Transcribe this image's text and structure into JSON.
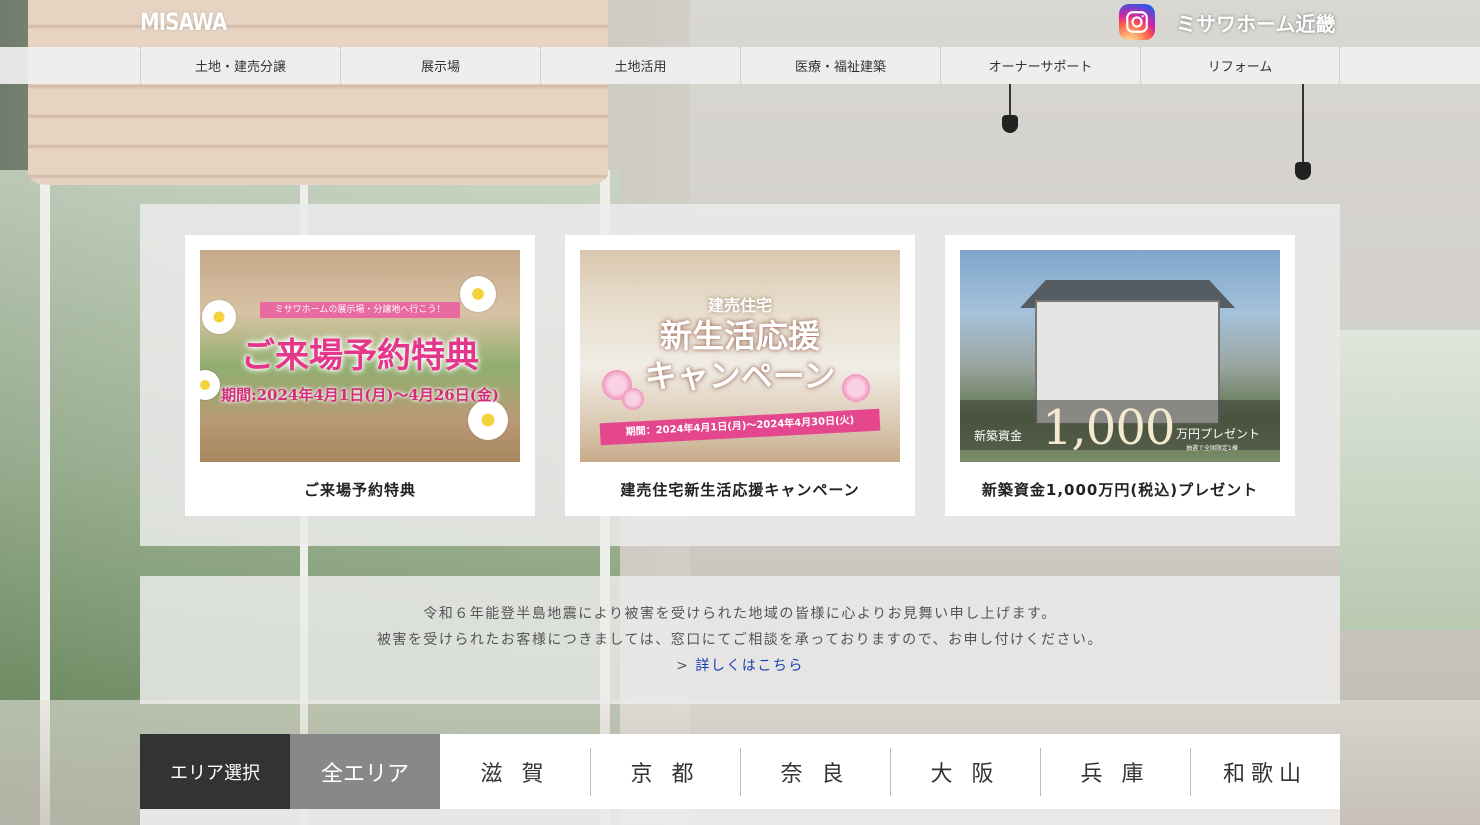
{
  "header": {
    "logo_text": "MISAWA",
    "brand_text": "ミサワホーム近畿",
    "nav": [
      "土地・建売分譲",
      "展示場",
      "土地活用",
      "医療・福祉建築",
      "オーナーサポート",
      "リフォーム"
    ]
  },
  "campaigns": [
    {
      "caption": "ご来場予約特典",
      "banner": {
        "ribbon": "ミサワホームの展示場・分譲地へ行こう！",
        "headline": "ご来場予約特典",
        "period": "期間:2024年4月1日(月)〜4月26日(金)"
      }
    },
    {
      "caption": "建売住宅新生活応援キャンペーン",
      "banner": {
        "kicker": "建売住宅",
        "headline_1": "新生活応援",
        "headline_2": "キャンペーン",
        "period": "期間：2024年4月1日(月)〜2024年4月30日(火)"
      }
    },
    {
      "caption": "新築資金1,000万円(税込)プレゼント",
      "banner": {
        "label_left": "新築資金",
        "amount": "1,000",
        "label_right": "万円プレゼント",
        "note": "抽選で全国限定1棟"
      }
    }
  ],
  "notice": {
    "line1": "令和６年能登半島地震により被害を受けられた地域の皆様に心よりお見舞い申し上げます。",
    "line2": "被害を受けられたお客様につきましては、窓口にてご相談を承っておりますので、お申し付けください。",
    "more_prefix": "> ",
    "more_link": "詳しくはこちら"
  },
  "area": {
    "label": "エリア選択",
    "all": "全エリア",
    "items": [
      "滋 賀",
      "京 都",
      "奈 良",
      "大 阪",
      "兵 庫",
      "和歌山"
    ]
  },
  "colors": {
    "accent_pink": "#e4368a",
    "area_label_bg": "#333333",
    "area_all_bg": "#888888",
    "link_blue": "#1a3fb4"
  },
  "icons": {
    "instagram": "instagram-icon"
  }
}
